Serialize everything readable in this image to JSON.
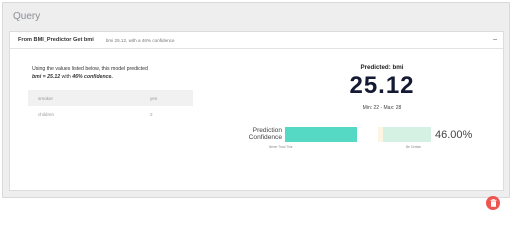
{
  "frame": {
    "title": "Query"
  },
  "panel": {
    "title": "From BMI_Predictor Get bmi",
    "subtitle": "bmi 25.12, with a 46% confidence",
    "collapse_glyph": "–",
    "description_line1": "Using the values listed below, this model predicted",
    "description_pred": "bmi = 25.12",
    "description_with": " with ",
    "description_conf": "46% confidence.",
    "inputs": [
      {
        "name": "smoker",
        "value": "yes"
      },
      {
        "name": "children",
        "value": "2"
      }
    ]
  },
  "prediction": {
    "label": "Predicted: bmi",
    "value": "25.12",
    "range": "Min: 22 - Max: 28"
  },
  "confidence": {
    "label_line1": "Prediction",
    "label_line2": "Confidence",
    "value_text": "46.00%",
    "value": 0.46,
    "min_label": "Never Trust This",
    "max_label": "Be Certain",
    "colors": {
      "low": "#56d9c4",
      "high": "#d4f1e4"
    }
  },
  "actions": {
    "delete_icon": "trash-icon",
    "delete_color": "#ef5350"
  }
}
